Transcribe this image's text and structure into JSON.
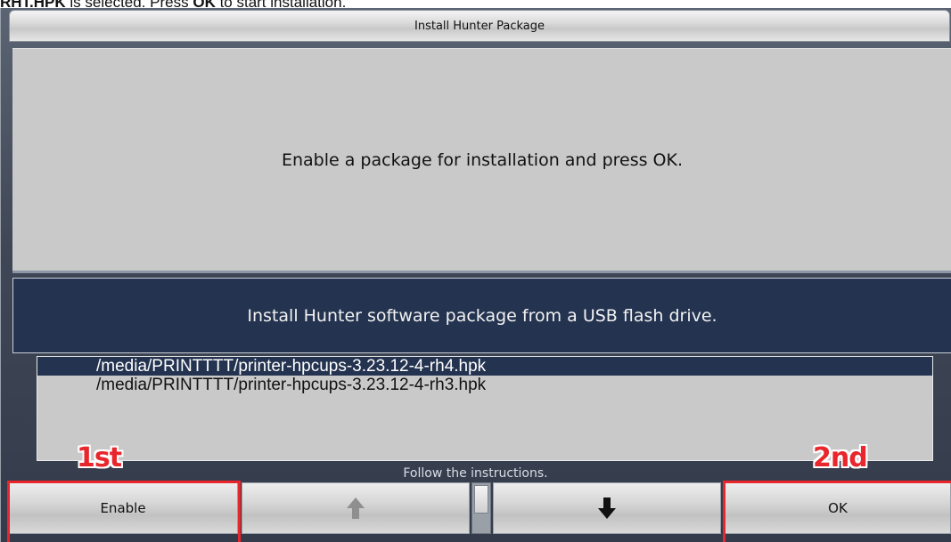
{
  "caption": {
    "prefix": "RHT.HPK",
    "middle": " is selected. Press ",
    "ok_word": "OK",
    "suffix": " to start installation."
  },
  "window": {
    "title": "Install Hunter Package",
    "instruction": "Enable a package for installation and press OK.",
    "description": "Install Hunter software package from a USB flash drive.",
    "status": "Follow the instructions."
  },
  "file_list": {
    "items": [
      {
        "path": "/media/PRINTTTT/printer-hpcups-3.23.12-4-rh4.hpk",
        "selected": true
      },
      {
        "path": "/media/PRINTTTT/printer-hpcups-3.23.12-4-rh3.hpk",
        "selected": false
      }
    ]
  },
  "annotations": {
    "first": "1st",
    "second": "2nd",
    "highlight_color": "#e8262b"
  },
  "toolbar": {
    "enable_label": "Enable",
    "up_icon": "arrow-up-icon",
    "down_icon": "arrow-down-icon",
    "ok_label": "OK"
  },
  "colors": {
    "selected_bg": "#24334f",
    "panel_bg": "#c9c9c9",
    "window_bg": "#3f4757"
  }
}
